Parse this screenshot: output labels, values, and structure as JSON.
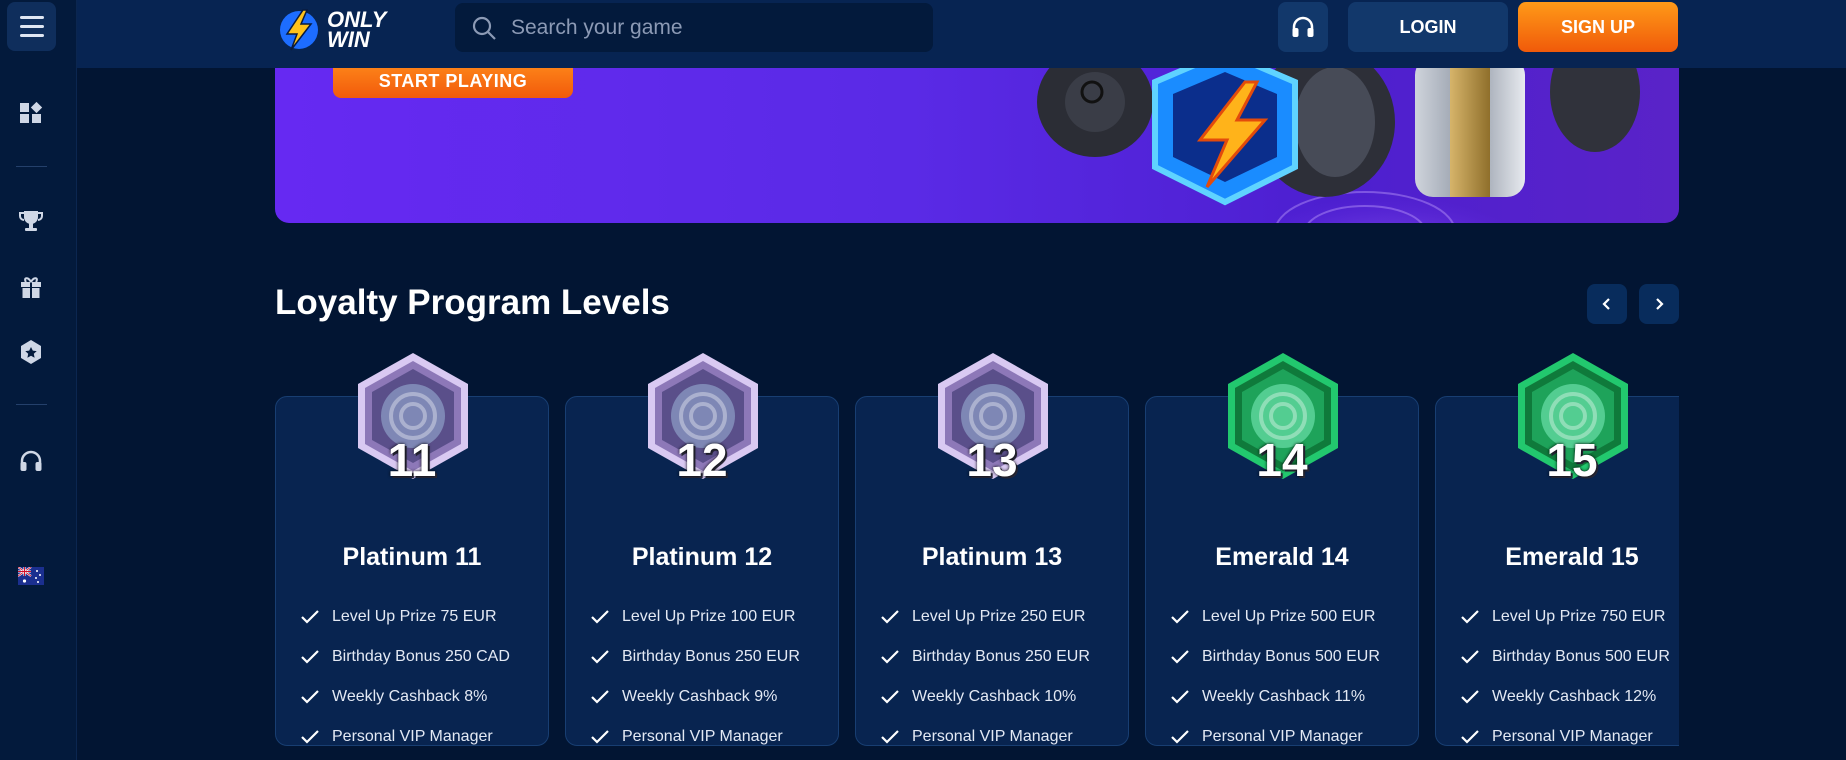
{
  "header": {
    "logo_text_line1": "ONLY",
    "logo_text_line2": "WIN",
    "search_placeholder": "Search your game",
    "login_label": "LOGIN",
    "signup_label": "SIGN UP"
  },
  "sidebar": {
    "icons": [
      "menu-icon",
      "grid-icon",
      "trophy-icon",
      "gift-icon",
      "badge-star-icon",
      "headset-icon",
      "australia-flag-icon"
    ]
  },
  "banner": {
    "cta_label": "START PLAYING"
  },
  "loyalty": {
    "title": "Loyalty Program Levels",
    "levels": [
      {
        "number": "11",
        "name": "Platinum 11",
        "tier": "platinum",
        "perks": [
          "Level Up Prize 75 EUR",
          "Birthday Bonus 250 CAD",
          "Weekly Cashback 8%",
          "Personal VIP Manager"
        ]
      },
      {
        "number": "12",
        "name": "Platinum 12",
        "tier": "platinum",
        "perks": [
          "Level Up Prize 100 EUR",
          "Birthday Bonus 250 EUR",
          "Weekly Cashback 9%",
          "Personal VIP Manager"
        ]
      },
      {
        "number": "13",
        "name": "Platinum 13",
        "tier": "platinum",
        "perks": [
          "Level Up Prize 250 EUR",
          "Birthday Bonus 250 EUR",
          "Weekly Cashback 10%",
          "Personal VIP Manager"
        ]
      },
      {
        "number": "14",
        "name": "Emerald 14",
        "tier": "emerald",
        "perks": [
          "Level Up Prize 500 EUR",
          "Birthday Bonus 500 EUR",
          "Weekly Cashback 11%",
          "Personal VIP Manager"
        ]
      },
      {
        "number": "15",
        "name": "Emerald 15",
        "tier": "emerald",
        "perks": [
          "Level Up Prize 750 EUR",
          "Birthday Bonus 500 EUR",
          "Weekly Cashback 12%",
          "Personal VIP Manager"
        ]
      }
    ]
  },
  "colors": {
    "background": "#021533",
    "header": "#072452",
    "card": "#082450",
    "accent_orange": "#f47b12",
    "banner_purple": "#6629f2",
    "platinum": "#c9b8e8",
    "emerald": "#1fc16b"
  }
}
